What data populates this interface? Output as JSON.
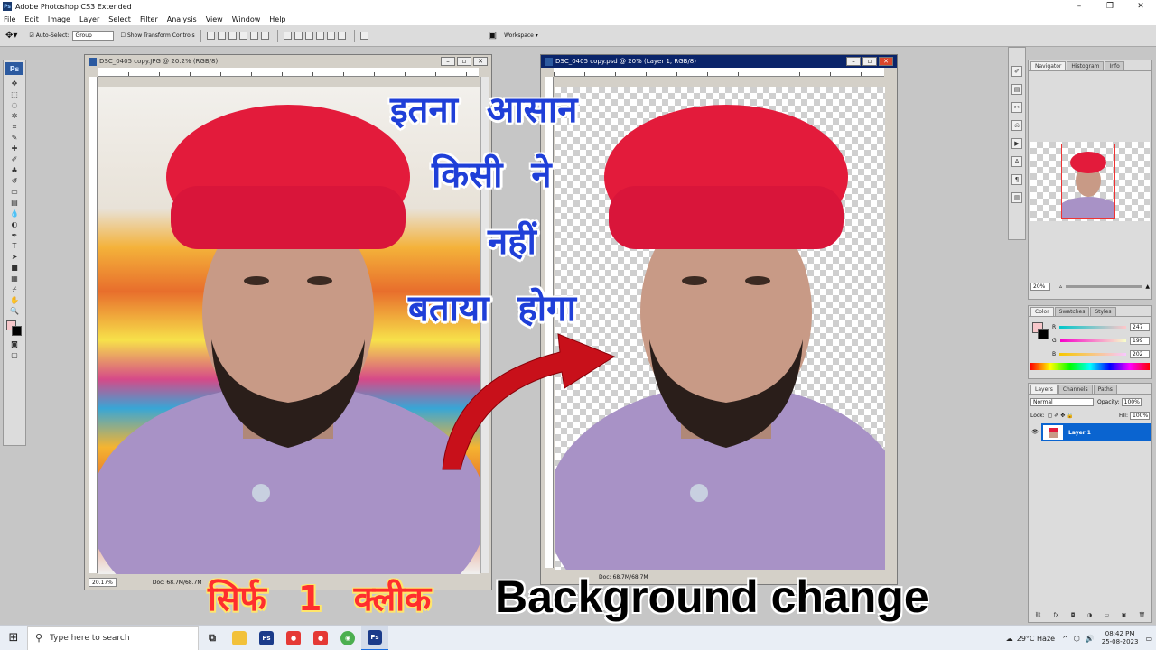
{
  "app": {
    "title": "Adobe Photoshop CS3 Extended"
  },
  "window_controls": {
    "minimize": "–",
    "maximize": "❐",
    "close": "✕"
  },
  "menu": [
    "File",
    "Edit",
    "Image",
    "Layer",
    "Select",
    "Filter",
    "Analysis",
    "View",
    "Window",
    "Help"
  ],
  "options": {
    "auto_select_label": "Auto-Select:",
    "auto_select_value": "Group",
    "show_transform_label": "Show Transform Controls",
    "workspace_label": "Workspace ▾"
  },
  "toolbox": {
    "logo": "Ps"
  },
  "docs": [
    {
      "title": "DSC_0405 copy.JPG @ 20.2% (RGB/8)",
      "zoom": "20.17%",
      "doc_info": "Doc: 68.7M/68.7M"
    },
    {
      "title": "DSC_0405 copy.psd @ 20% (Layer 1, RGB/8)",
      "doc_info": "Doc: 68.7M/68.7M"
    }
  ],
  "navigator": {
    "tabs": [
      "Navigator",
      "Histogram",
      "Info"
    ],
    "zoom": "20%"
  },
  "color_panel": {
    "tabs": [
      "Color",
      "Swatches",
      "Styles"
    ],
    "channels": [
      {
        "label": "R",
        "value": "247"
      },
      {
        "label": "G",
        "value": "199"
      },
      {
        "label": "B",
        "value": "202"
      }
    ],
    "fg_color": "#f7c7ca"
  },
  "layers_panel": {
    "tabs": [
      "Layers",
      "Channels",
      "Paths"
    ],
    "blend_mode": "Normal",
    "opacity_label": "Opacity:",
    "opacity": "100%",
    "lock_label": "Lock:",
    "fill_label": "Fill:",
    "fill": "100%",
    "layer_name": "Layer 1"
  },
  "overlay": {
    "line1": "इतना आसान",
    "line2": "किसी ने",
    "line3": "नहीं",
    "line4": "बताया होगा",
    "bottom_hindi": "सिर्फ 1 क्लीक",
    "bottom_en": "Background change"
  },
  "taskbar": {
    "search_placeholder": "Type here to search",
    "weather": "29°C Haze",
    "time": "08:42 PM",
    "date": "25-08-2023",
    "apps": [
      {
        "name": "file-explorer",
        "label": "",
        "color": "#f2c13a"
      },
      {
        "name": "photoshop",
        "label": "Ps",
        "color": "#1b3b8a"
      },
      {
        "name": "screen-recorder",
        "label": "●",
        "color": "#e53935"
      },
      {
        "name": "screen-recorder-2",
        "label": "●",
        "color": "#e53935"
      },
      {
        "name": "chrome",
        "label": "◉",
        "color": "#4caf50"
      },
      {
        "name": "photoshop-active",
        "label": "Ps",
        "color": "#1b3b8a"
      }
    ]
  }
}
